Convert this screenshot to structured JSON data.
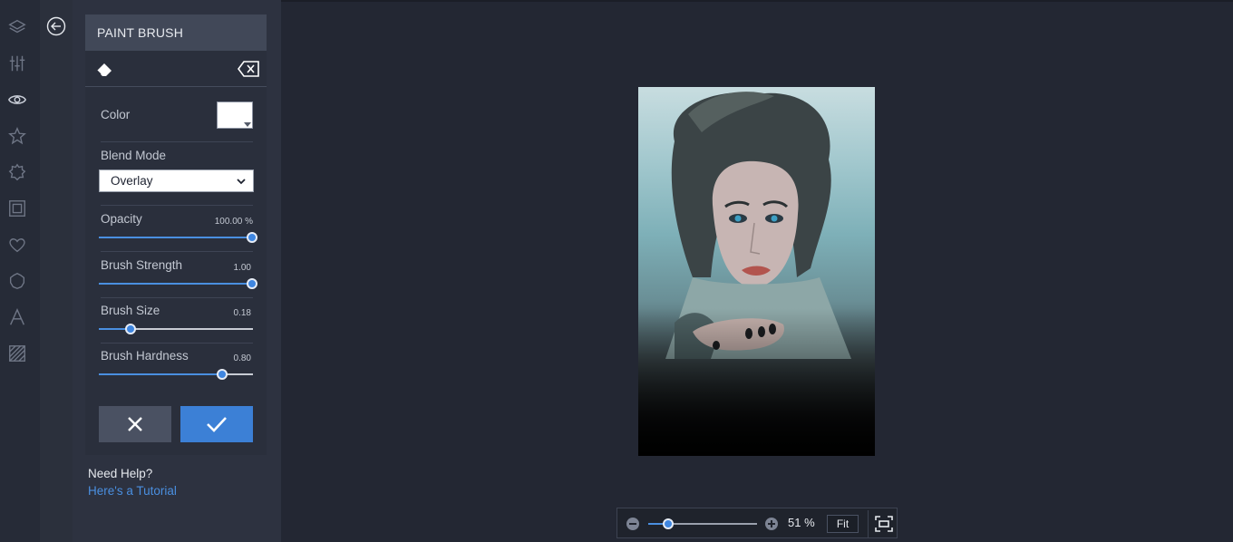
{
  "rail": {
    "icons": [
      "layers-icon",
      "sliders-icon",
      "eye-icon",
      "star-icon",
      "badge-icon",
      "frame-icon",
      "heart-icon",
      "shape-icon",
      "text-icon",
      "texture-icon"
    ]
  },
  "panel": {
    "title": "PAINT BRUSH",
    "color_label": "Color",
    "color_value": "#ffffff",
    "blend_label": "Blend Mode",
    "blend_value": "Overlay",
    "opacity": {
      "label": "Opacity",
      "value_text": "100.00 %",
      "fraction": 1.0
    },
    "strength": {
      "label": "Brush Strength",
      "value_text": "1.00",
      "fraction": 1.0
    },
    "size": {
      "label": "Brush Size",
      "value_text": "0.18",
      "fraction": 0.18
    },
    "hardness": {
      "label": "Brush Hardness",
      "value_text": "0.80",
      "fraction": 0.8
    }
  },
  "help": {
    "title": "Need Help?",
    "link": "Here's a Tutorial"
  },
  "zoom": {
    "value_text": "51 %",
    "fraction": 0.15,
    "fit_label": "Fit"
  },
  "colors": {
    "accent": "#3c80d6",
    "panel_bg": "#2a2f3c",
    "canvas_bg": "#232733"
  }
}
